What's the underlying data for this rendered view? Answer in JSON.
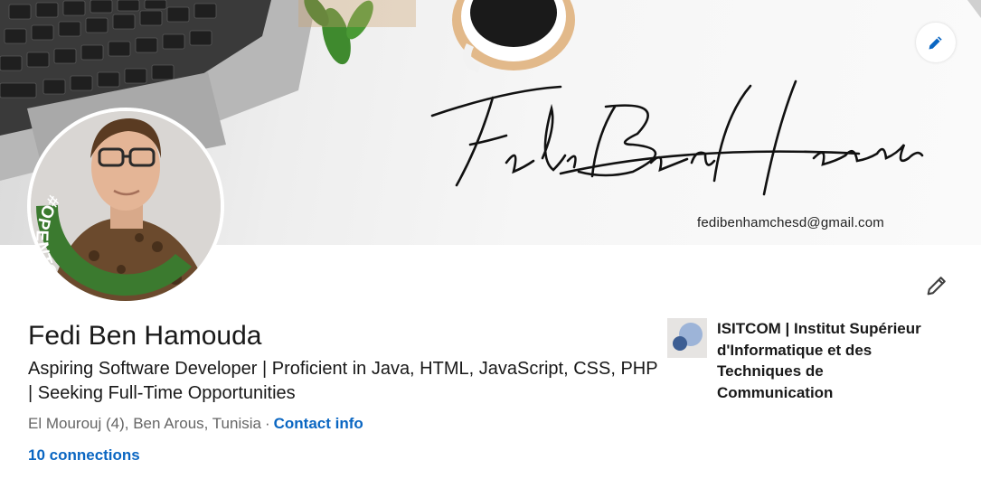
{
  "banner": {
    "signature": "Fedi BenHamouda",
    "email": "fedibenhamchesd@gmail.com",
    "edit_icon": "pencil-icon"
  },
  "profile": {
    "name": "Fedi Ben Hamouda",
    "headline": "Aspiring Software Developer | Proficient in Java, HTML, JavaScript, CSS, PHP | Seeking Full-Time Opportunities",
    "location": "El Mourouj (4), Ben Arous, Tunisia",
    "separator": "·",
    "contact_info_label": "Contact info",
    "connections_label": "10 connections",
    "open_to_work_badge": "#OPENTOWORK",
    "edit_icon": "pencil-icon"
  },
  "education": {
    "school_name": "ISITCOM | Institut Supérieur d'Informatique et des Techniques de Communication"
  },
  "colors": {
    "link": "#0a66c2",
    "open_to_work_green": "#3b7a2f",
    "text_primary": "#191919",
    "text_secondary": "#666666"
  }
}
